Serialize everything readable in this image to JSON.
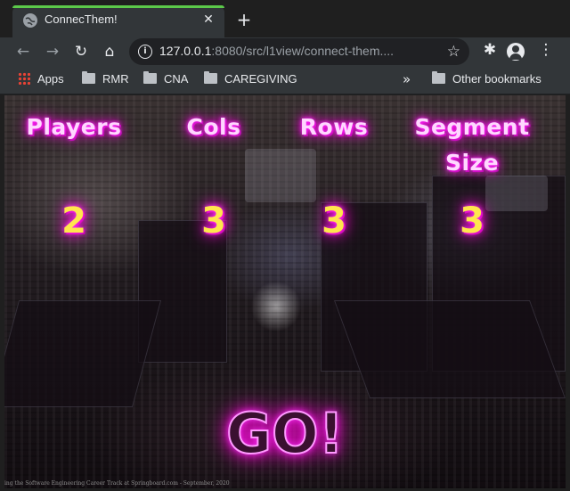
{
  "browser": {
    "tab": {
      "title": "ConnecThem!"
    },
    "address": {
      "host": "127.0.0.1",
      "rest": ":8080/src/l1view/connect-them...."
    },
    "bookmarks": {
      "apps_label": "Apps",
      "folders": [
        "RMR",
        "CNA",
        "CAREGIVING"
      ],
      "overflow_label": "»",
      "other_label": "Other bookmarks"
    }
  },
  "game": {
    "settings": [
      {
        "label": "Players",
        "value": "2"
      },
      {
        "label": "Cols",
        "value": "3"
      },
      {
        "label": "Rows",
        "value": "3"
      },
      {
        "label": "Segment Size",
        "value": "3"
      }
    ],
    "go_label": "GO!",
    "credit": "ing the Software Engineering Career Track at Springboard.com - September, 2020"
  },
  "colors": {
    "label_glow": "#ff00dd",
    "value_text": "#ffe64d",
    "tab_loading": "#5cc94a"
  }
}
